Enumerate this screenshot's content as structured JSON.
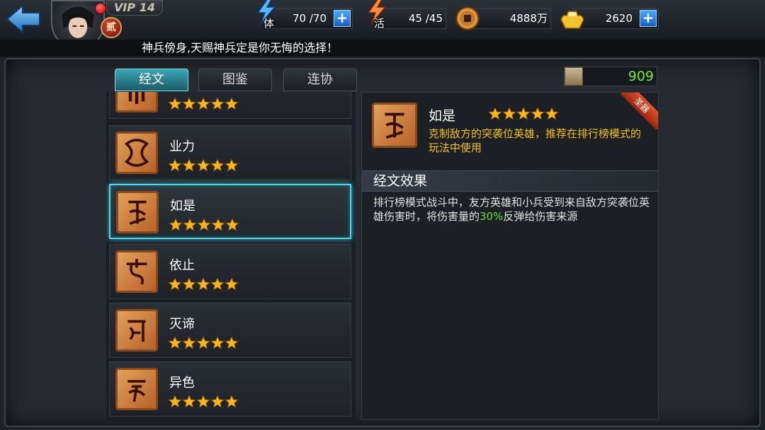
{
  "header": {
    "vip_label": "VIP 14",
    "rank_label": "贰",
    "stamina": {
      "label": "体",
      "value": "70 /70"
    },
    "activity": {
      "label": "活",
      "value": "45 /45"
    },
    "coins": {
      "value": "4888万"
    },
    "gold": {
      "value": "2620"
    }
  },
  "marquee": "神兵傍身,天赐神兵定是你无悔的选择！",
  "tabs": [
    {
      "label": "经文",
      "active": true
    },
    {
      "label": "图鉴",
      "active": false
    },
    {
      "label": "连协",
      "active": false
    }
  ],
  "scroll_resource": {
    "value": "909"
  },
  "list": {
    "items": [
      {
        "name": "",
        "stars": 5,
        "selected": false
      },
      {
        "name": "业力",
        "stars": 5,
        "selected": false
      },
      {
        "name": "如是",
        "stars": 5,
        "selected": true
      },
      {
        "name": "依止",
        "stars": 5,
        "selected": false
      },
      {
        "name": "灭谛",
        "stars": 5,
        "selected": false
      },
      {
        "name": "异色",
        "stars": 5,
        "selected": false
      }
    ]
  },
  "detail": {
    "name": "如是",
    "stars": 5,
    "corner_tag": "圣器",
    "description": "克制敌方的突袭位英雄，推荐在排行榜模式的玩法中使用",
    "section_title": "经文效果",
    "effect_before": "排行榜模式战斗中，友方英雄和小兵受到来自敌方突袭位英雄伤害时，将伤害量的",
    "effect_highlight": "30%",
    "effect_after": "反弹给伤害来源"
  },
  "colors": {
    "accent_cyan": "#5cd4e8",
    "desc_yellow": "#f2c11f",
    "highlight_green": "#5fe04b",
    "star_gold": "#f6b521"
  }
}
